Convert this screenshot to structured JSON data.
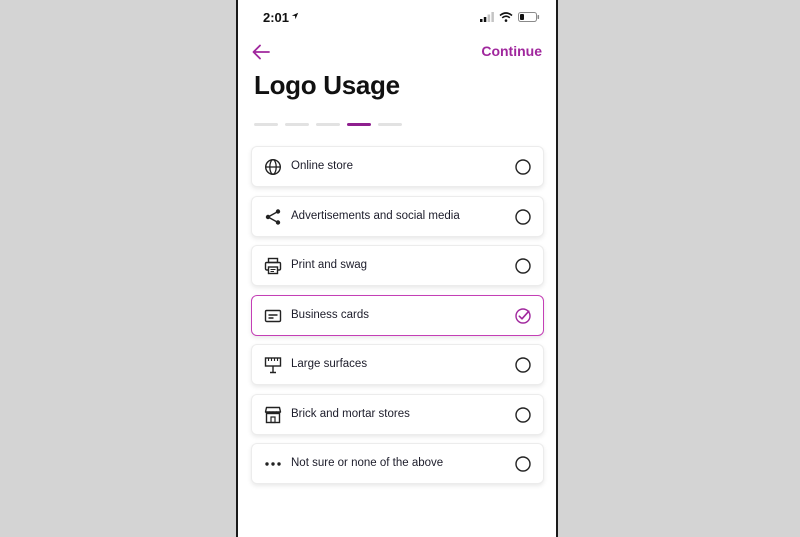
{
  "status_bar": {
    "time": "2:01"
  },
  "nav": {
    "continue_label": "Continue"
  },
  "page": {
    "title": "Logo Usage"
  },
  "progress": {
    "steps": 5,
    "current_step": 4
  },
  "options": [
    {
      "label": "Online store",
      "icon": "globe-icon",
      "selected": false
    },
    {
      "label": "Advertisements and social media",
      "icon": "share-icon",
      "selected": false
    },
    {
      "label": "Print and swag",
      "icon": "printer-icon",
      "selected": false
    },
    {
      "label": "Business cards",
      "icon": "business-card-icon",
      "selected": true
    },
    {
      "label": "Large surfaces",
      "icon": "billboard-icon",
      "selected": false
    },
    {
      "label": "Brick and mortar stores",
      "icon": "storefront-icon",
      "selected": false
    },
    {
      "label": "Not sure or none of the above",
      "icon": "more-dots-icon",
      "selected": false
    }
  ],
  "colors": {
    "accent": "#a0279d",
    "selected_border": "#c43fb6",
    "progress_active": "#8e1f8e"
  }
}
